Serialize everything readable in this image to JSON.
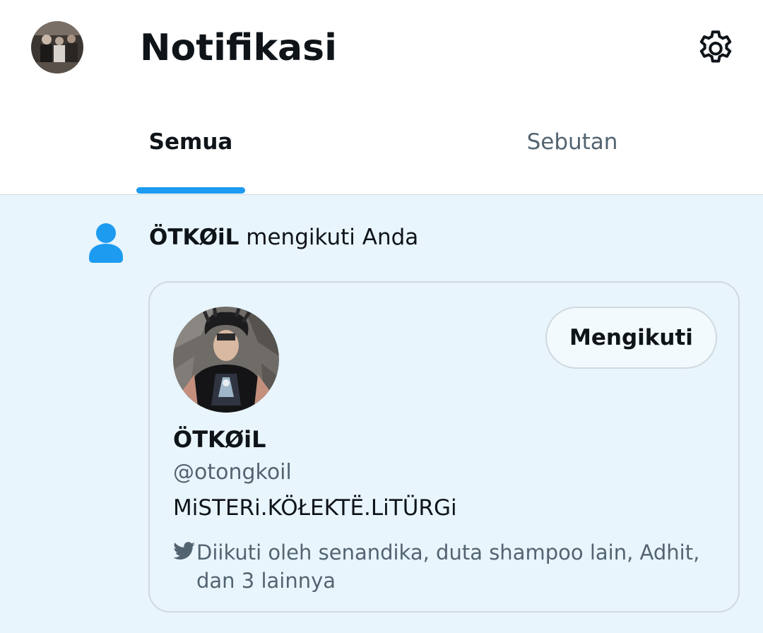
{
  "header": {
    "title": "Notifikasi",
    "avatar_icon": "user-avatar-photo",
    "settings_icon": "gear-icon"
  },
  "tabs": [
    {
      "label": "Semua",
      "active": true
    },
    {
      "label": "Sebutan",
      "active": false
    }
  ],
  "notification": {
    "icon": "person-icon",
    "actor_name": "ÖTKØiL",
    "action_text": " mengikuti Anda",
    "card": {
      "display_name": "ÖTKØiL",
      "handle": "@otongkoil",
      "bio": "MiSTERi.KÖŁEKTË.LiTÜRGi",
      "follow_button_label": "Mengikuti",
      "followed_by_icon": "bird-icon",
      "followed_by_text": "Diikuti oleh senandika, duta shampoo lain, Adhit, dan 3 lainnya"
    }
  },
  "colors": {
    "accent": "#1d9bf0",
    "notification_bg": "#e8f5fd",
    "secondary_text": "#536471",
    "border": "#cfd9de",
    "primary_text": "#0f1419"
  }
}
